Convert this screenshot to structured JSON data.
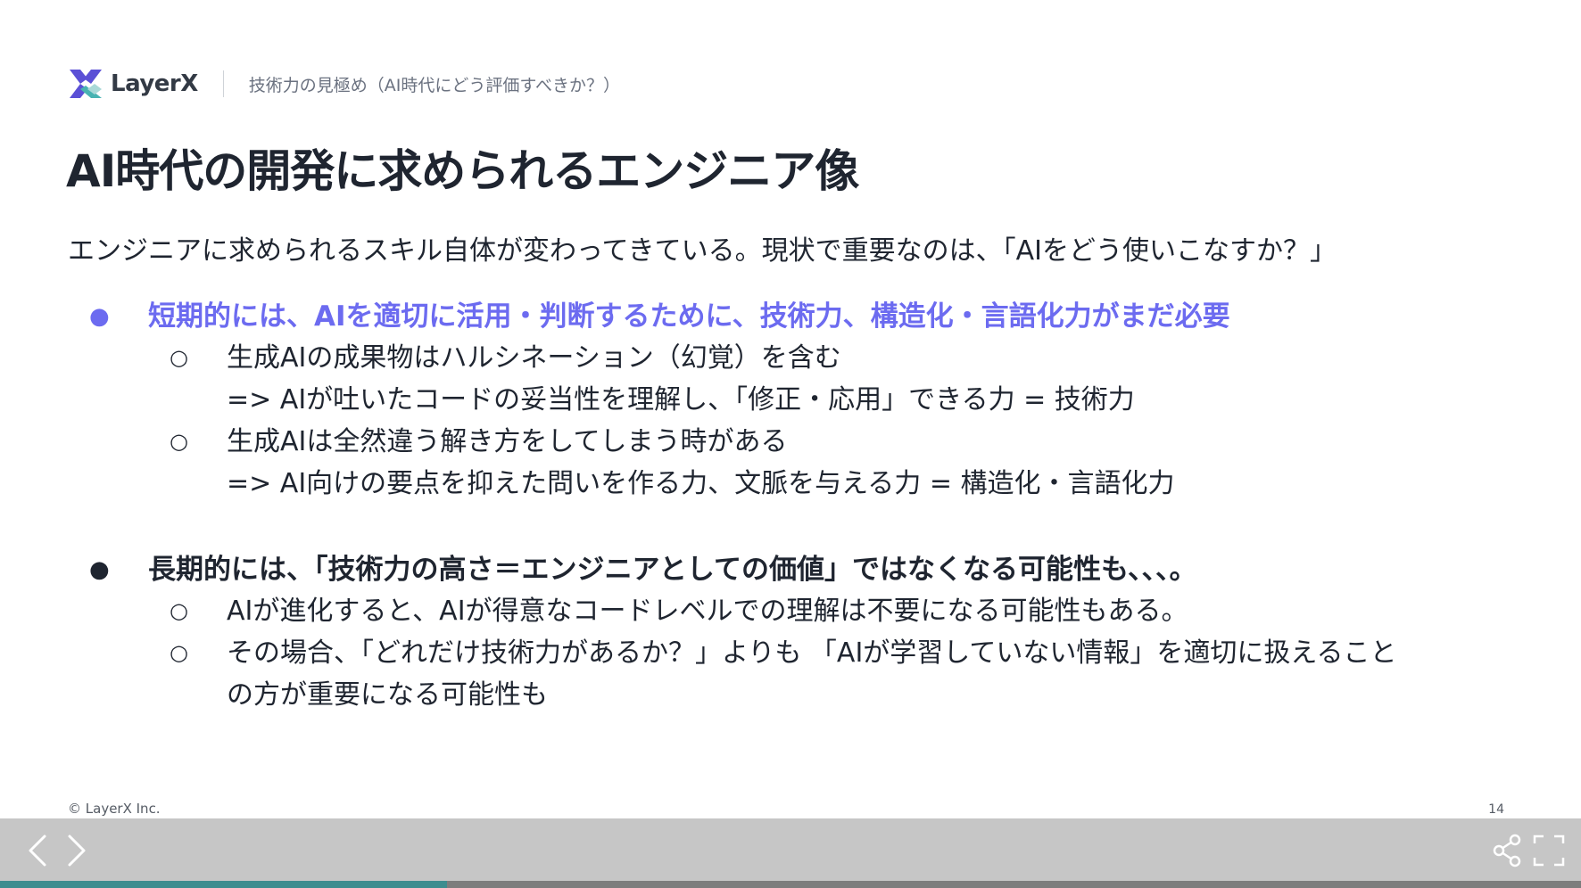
{
  "header": {
    "brand": "LayerX",
    "subtitle": "技術力の見極め（AI時代にどう評価すべきか？）"
  },
  "slide": {
    "title": "AI時代の開発に求められるエンジニア像",
    "intro": "エンジニアに求められるスキル自体が変わってきている。現状で重要なのは、「AIをどう使いこなすか？」",
    "bullets": [
      {
        "text": "短期的には、AIを適切に活用・判断するために、技術力、構造化・言語化力がまだ必要",
        "subs": [
          {
            "line1": "生成AIの成果物はハルシネーション（幻覚）を含む",
            "line2": "=> AIが吐いたコードの妥当性を理解し、「修正・応用」できる力 = 技術力"
          },
          {
            "line1": "生成AIは全然違う解き方をしてしまう時がある",
            "line2": "=> AI向けの要点を抑えた問いを作る力、文脈を与える力 = 構造化・言語化力"
          }
        ]
      },
      {
        "text": "長期的には、「技術力の高さ＝エンジニアとしての価値」ではなくなる可能性も、、、。",
        "subs": [
          {
            "line1": "AIが進化すると、AIが得意なコードレベルでの理解は不要になる可能性もある。",
            "line2": ""
          },
          {
            "line1": "その場合、「どれだけ技術力があるか？」よりも 「AIが学習していない情報」を適切に扱えること",
            "line2": "の方が重要になる可能性も"
          }
        ]
      }
    ],
    "bullet_marker": "●",
    "sub_marker": "○",
    "copyright": "© LayerX Inc.",
    "page_number": "14"
  },
  "viewer": {
    "progress_fraction": 0.283
  },
  "colors": {
    "highlight": "#6c6bf0",
    "logo_purple": "#5b50d6",
    "logo_teal": "#48b3b2",
    "progress": "#3d8d8f",
    "control_bar": "#c6c6c6"
  }
}
